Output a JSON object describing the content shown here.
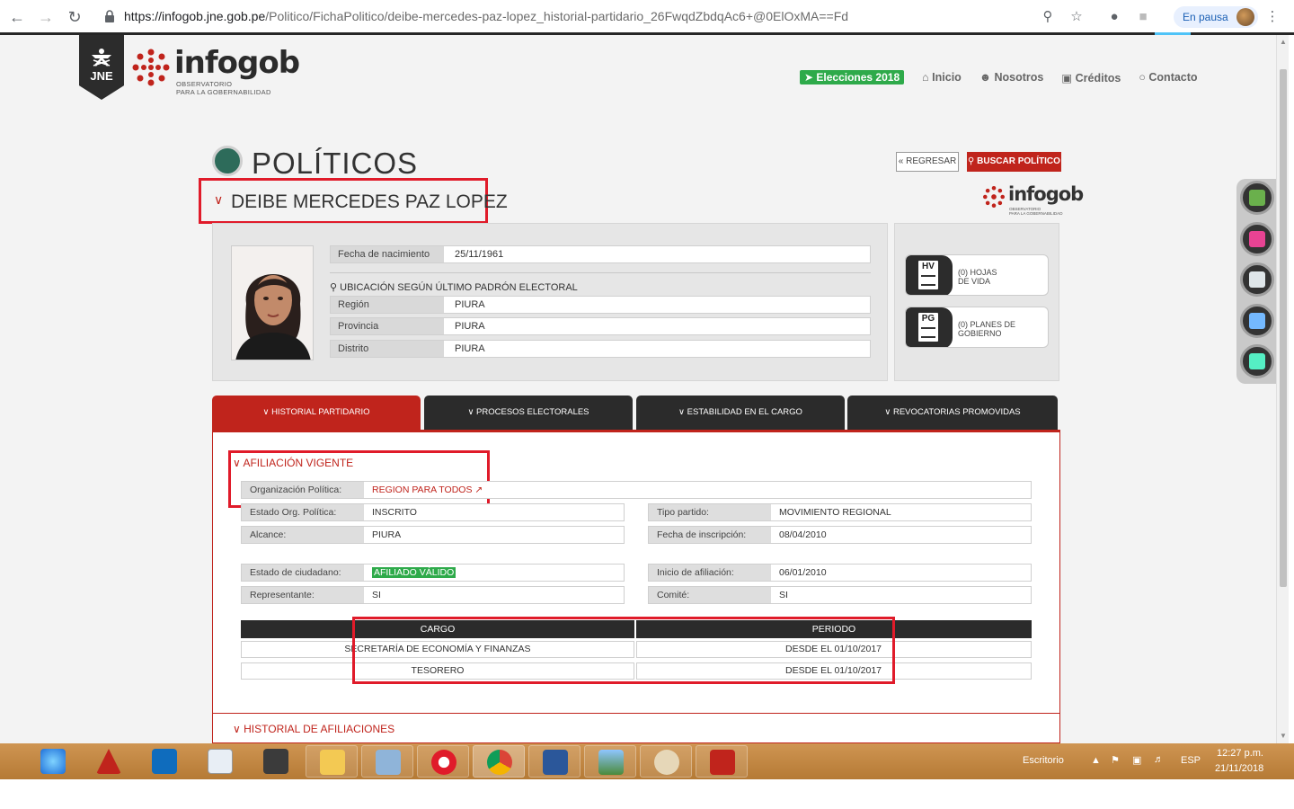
{
  "browser": {
    "url_host": "https://infogob.jne.gob.pe",
    "url_path": "/Politico/FichaPolitico/deibe-mercedes-paz-lopez_historial-partidario_26FwqdZbdqAc6+@0ElOxMA==Fd",
    "paused_label": "En pausa"
  },
  "header": {
    "jne_label": "JNE",
    "logo_word": "infogob",
    "logo_sub_1": "OBSERVATORIO",
    "logo_sub_2": "PARA LA GOBERNABILIDAD",
    "nav": [
      "Elecciones 2018",
      "Inicio",
      "Nosotros",
      "Créditos",
      "Contacto"
    ]
  },
  "page": {
    "title": "POLÍTICOS",
    "back_label": "« REGRESAR",
    "search_label": "BUSCAR POLÍTICO",
    "person_name": "DEIBE MERCEDES PAZ LOPEZ"
  },
  "profile": {
    "birth_label": "Fecha de nacimiento",
    "birth_value": "25/11/1961",
    "location_heading": "UBICACIÓN SEGÚN ÚLTIMO PADRÓN ELECTORAL",
    "region_label": "Región",
    "region_value": "PIURA",
    "province_label": "Provincia",
    "province_value": "PIURA",
    "district_label": "Distrito",
    "district_value": "PIURA"
  },
  "documents": {
    "hv_code": "HV",
    "hv_label_1": "(0) HOJAS",
    "hv_label_2": "DE VIDA",
    "pg_code": "PG",
    "pg_label_1": "(0) PLANES DE",
    "pg_label_2": "GOBIERNO"
  },
  "tabs": [
    "HISTORIAL PARTIDARIO",
    "PROCESOS ELECTORALES",
    "ESTABILIDAD EN EL CARGO",
    "REVOCATORIAS PROMOVIDAS"
  ],
  "affiliation": {
    "title": "AFILIACIÓN VIGENTE",
    "org_label": "Organización Política:",
    "org_value": "REGION PARA TODOS",
    "estado_org_label": "Estado Org. Política:",
    "estado_org_value": "INSCRITO",
    "tipo_label": "Tipo partido:",
    "tipo_value": "MOVIMIENTO REGIONAL",
    "alcance_label": "Alcance:",
    "alcance_value": "PIURA",
    "fecha_insc_label": "Fecha de inscripción:",
    "fecha_insc_value": "08/04/2010",
    "estado_ciud_label": "Estado de ciudadano:",
    "estado_ciud_value": "AFILIADO VÁLIDO",
    "inicio_label": "Inicio de afiliación:",
    "inicio_value": "06/01/2010",
    "representante_label": "Representante:",
    "representante_value": "SI",
    "comite_label": "Comité:",
    "comite_value": "SI"
  },
  "cargos": {
    "headers": [
      "CARGO",
      "PERIODO"
    ],
    "rows": [
      {
        "cargo": "SECRETARÍA DE ECONOMÍA Y FINANZAS",
        "periodo": "DESDE EL 01/10/2017"
      },
      {
        "cargo": "TESORERO",
        "periodo": "DESDE EL 01/10/2017"
      }
    ]
  },
  "historial_title": "HISTORIAL DE AFILIACIONES",
  "taskbar": {
    "escritorio": "Escritorio",
    "lang": "ESP",
    "time": "12:27 p.m.",
    "date": "21/11/2018"
  },
  "colors": {
    "accent_red": "#c0241c",
    "highlight_red": "#e01b2a",
    "dark": "#2b2b2b",
    "green": "#2eaa4a"
  }
}
